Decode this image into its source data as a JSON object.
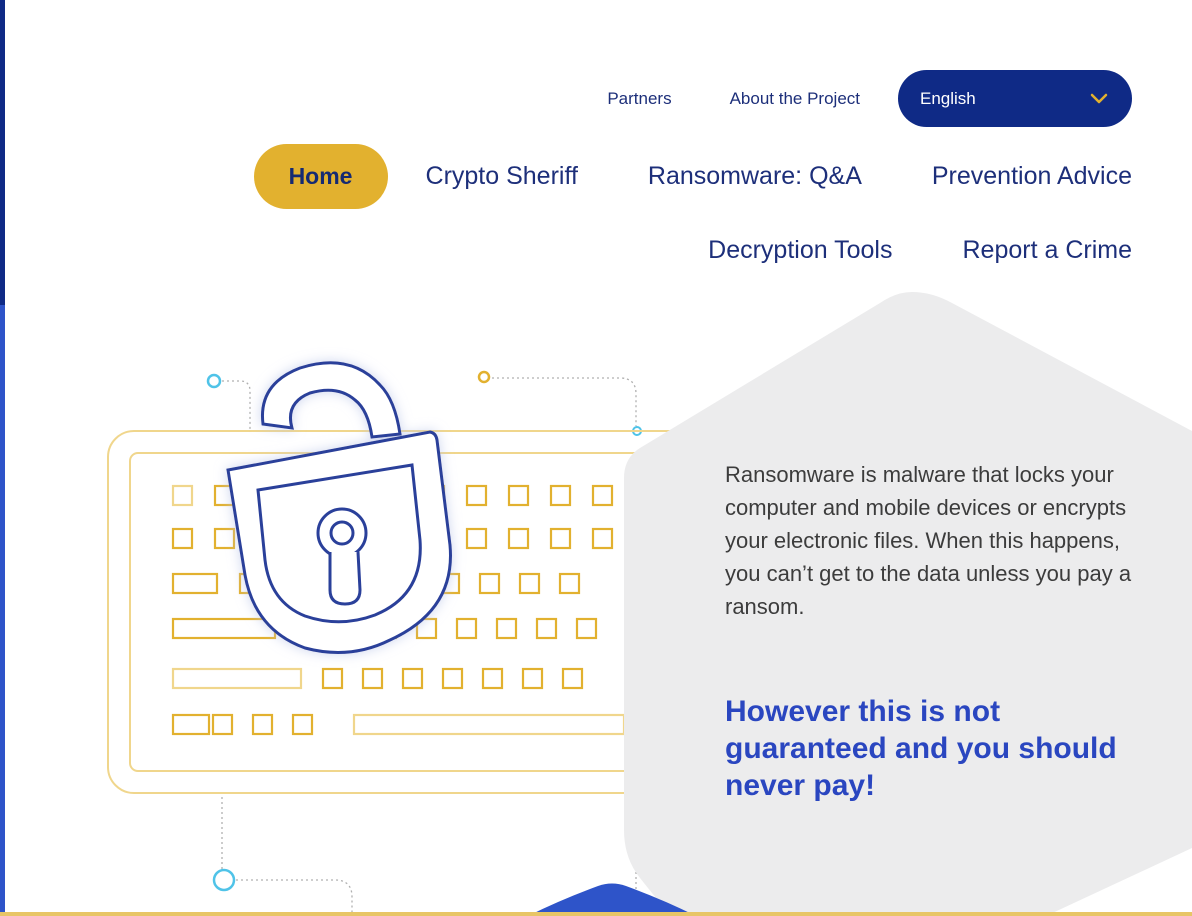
{
  "header": {
    "top_links": [
      {
        "label": "Partners"
      },
      {
        "label": "About the Project"
      }
    ],
    "language": {
      "selected": "English"
    }
  },
  "nav": {
    "main": [
      {
        "label": "Home",
        "active": true
      },
      {
        "label": "Crypto Sheriff"
      },
      {
        "label": "Ransomware: Q&A"
      },
      {
        "label": "Prevention Advice"
      }
    ],
    "sub": [
      {
        "label": "Decryption Tools"
      },
      {
        "label": "Report a Crime"
      }
    ]
  },
  "hero": {
    "description": "Ransomware is malware that locks your computer and mobile devices or encrypts your electronic files. When this happens, you can’t get to the data unless you pay a ransom.",
    "warning": "However this is not guaranteed and you should never pay!"
  },
  "colors": {
    "navy": "#0f2a86",
    "accent_yellow": "#e2b12f",
    "link_blue": "#1d2f7a",
    "warning_blue": "#2a46c0",
    "hexagon_gray": "#ececed"
  },
  "icons": {
    "language_dropdown": "chevron-down-icon",
    "illustration": "unlocked-padlock-keyboard"
  }
}
